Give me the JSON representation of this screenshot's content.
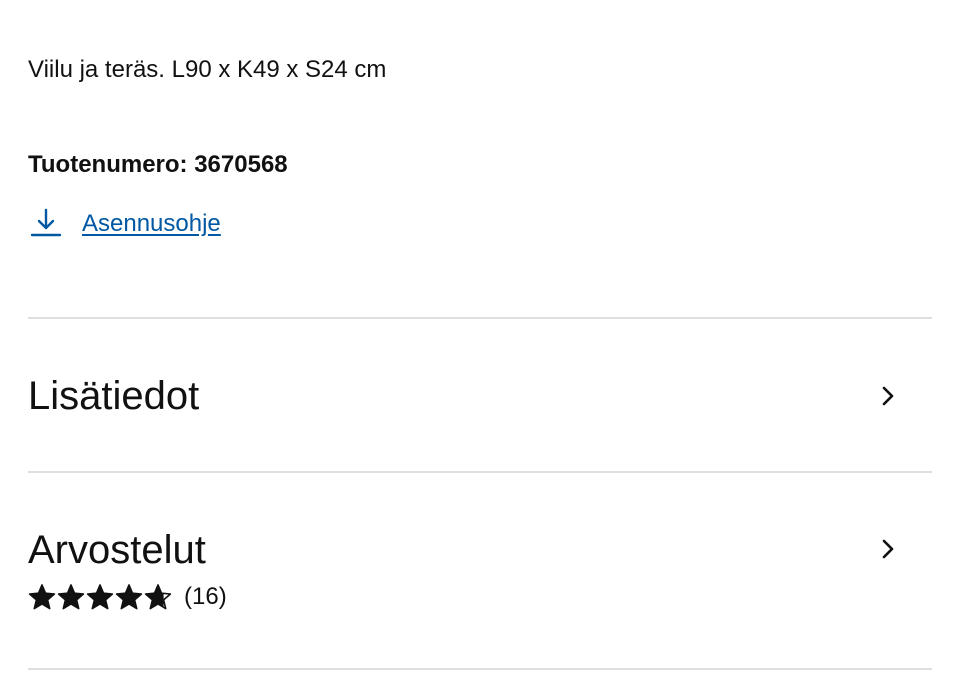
{
  "product": {
    "description": "Viilu ja teräs. L90 x K49 x S24 cm",
    "article_number": "Tuotenumero: 3670568"
  },
  "assembly": {
    "link_label": "Asennusohje",
    "icon": "download-icon"
  },
  "sections": {
    "more_info": {
      "title": "Lisätiedot",
      "icon": "chevron-right-icon"
    },
    "reviews": {
      "title": "Arvostelut",
      "icon": "chevron-right-icon",
      "rating": 4.7,
      "rating_max": 5,
      "count_label": "(16)"
    }
  },
  "colors": {
    "text": "#111111",
    "link": "#0058a3",
    "divider": "#dfdfdf"
  }
}
